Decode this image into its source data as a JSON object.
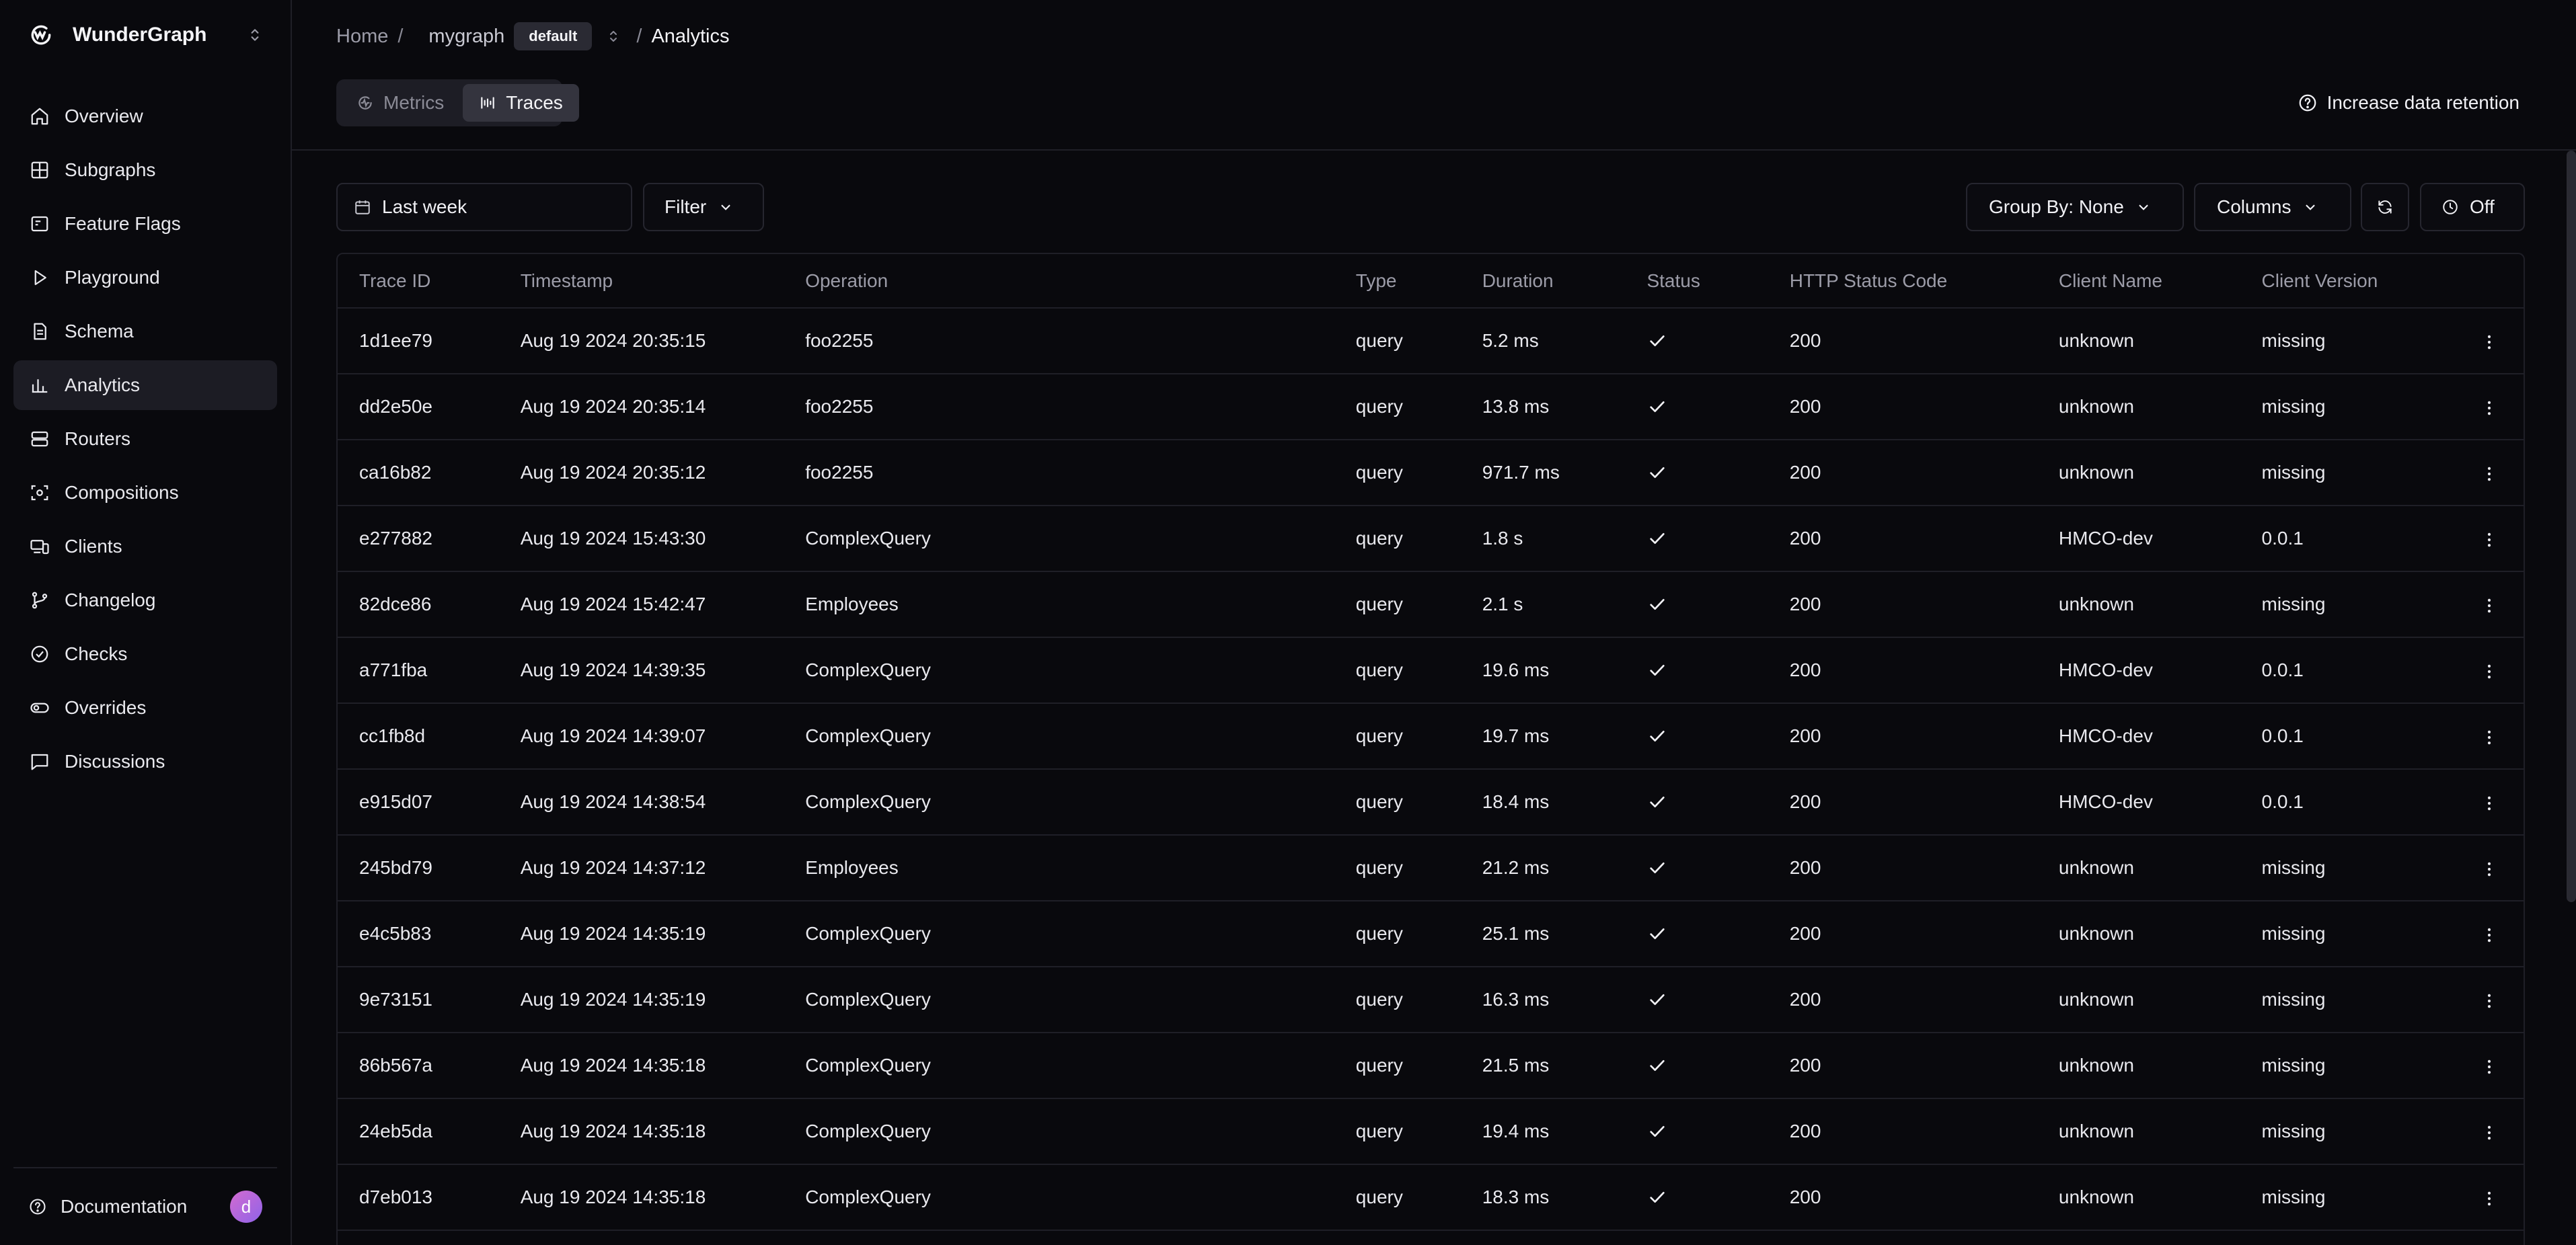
{
  "brand": {
    "name": "WunderGraph",
    "logo_icon": "wundergraph-logo-icon"
  },
  "sidebar": {
    "items": [
      {
        "label": "Overview",
        "icon": "home-icon"
      },
      {
        "label": "Subgraphs",
        "icon": "grid-icon"
      },
      {
        "label": "Feature Flags",
        "icon": "flag-icon"
      },
      {
        "label": "Playground",
        "icon": "play-icon"
      },
      {
        "label": "Schema",
        "icon": "file-icon"
      },
      {
        "label": "Analytics",
        "icon": "chart-icon",
        "active": true
      },
      {
        "label": "Routers",
        "icon": "server-icon"
      },
      {
        "label": "Compositions",
        "icon": "composition-icon"
      },
      {
        "label": "Clients",
        "icon": "devices-icon"
      },
      {
        "label": "Changelog",
        "icon": "branch-icon"
      },
      {
        "label": "Checks",
        "icon": "check-circle-icon"
      },
      {
        "label": "Overrides",
        "icon": "toggle-icon"
      },
      {
        "label": "Discussions",
        "icon": "message-icon"
      }
    ],
    "footer": {
      "label": "Documentation",
      "avatar_initial": "d"
    }
  },
  "breadcrumb": {
    "home": "Home",
    "sep": "/",
    "graph": "mygraph",
    "namespace": "default",
    "current": "Analytics"
  },
  "tabs": [
    {
      "label": "Metrics",
      "active": false
    },
    {
      "label": "Traces",
      "active": true
    }
  ],
  "retention_link": "Increase data retention",
  "toolbar": {
    "date_range": "Last week",
    "filter": "Filter",
    "group_by": "Group By: None",
    "columns": "Columns",
    "refresh_icon": "refresh-icon",
    "auto_refresh": "Off"
  },
  "table": {
    "columns": [
      "Trace ID",
      "Timestamp",
      "Operation",
      "Type",
      "Duration",
      "Status",
      "HTTP Status Code",
      "Client Name",
      "Client Version"
    ],
    "rows": [
      [
        "1d1ee79",
        "Aug 19 2024 20:35:15",
        "foo2255",
        "query",
        "5.2 ms",
        "200",
        "unknown",
        "missing"
      ],
      [
        "dd2e50e",
        "Aug 19 2024 20:35:14",
        "foo2255",
        "query",
        "13.8 ms",
        "200",
        "unknown",
        "missing"
      ],
      [
        "ca16b82",
        "Aug 19 2024 20:35:12",
        "foo2255",
        "query",
        "971.7 ms",
        "200",
        "unknown",
        "missing"
      ],
      [
        "e277882",
        "Aug 19 2024 15:43:30",
        "ComplexQuery",
        "query",
        "1.8 s",
        "200",
        "HMCO-dev",
        "0.0.1"
      ],
      [
        "82dce86",
        "Aug 19 2024 15:42:47",
        "Employees",
        "query",
        "2.1 s",
        "200",
        "unknown",
        "missing"
      ],
      [
        "a771fba",
        "Aug 19 2024 14:39:35",
        "ComplexQuery",
        "query",
        "19.6 ms",
        "200",
        "HMCO-dev",
        "0.0.1"
      ],
      [
        "cc1fb8d",
        "Aug 19 2024 14:39:07",
        "ComplexQuery",
        "query",
        "19.7 ms",
        "200",
        "HMCO-dev",
        "0.0.1"
      ],
      [
        "e915d07",
        "Aug 19 2024 14:38:54",
        "ComplexQuery",
        "query",
        "18.4 ms",
        "200",
        "HMCO-dev",
        "0.0.1"
      ],
      [
        "245bd79",
        "Aug 19 2024 14:37:12",
        "Employees",
        "query",
        "21.2 ms",
        "200",
        "unknown",
        "missing"
      ],
      [
        "e4c5b83",
        "Aug 19 2024 14:35:19",
        "ComplexQuery",
        "query",
        "25.1 ms",
        "200",
        "unknown",
        "missing"
      ],
      [
        "9e73151",
        "Aug 19 2024 14:35:19",
        "ComplexQuery",
        "query",
        "16.3 ms",
        "200",
        "unknown",
        "missing"
      ],
      [
        "86b567a",
        "Aug 19 2024 14:35:18",
        "ComplexQuery",
        "query",
        "21.5 ms",
        "200",
        "unknown",
        "missing"
      ],
      [
        "24eb5da",
        "Aug 19 2024 14:35:18",
        "ComplexQuery",
        "query",
        "19.4 ms",
        "200",
        "unknown",
        "missing"
      ],
      [
        "d7eb013",
        "Aug 19 2024 14:35:18",
        "ComplexQuery",
        "query",
        "18.3 ms",
        "200",
        "unknown",
        "missing"
      ]
    ]
  }
}
